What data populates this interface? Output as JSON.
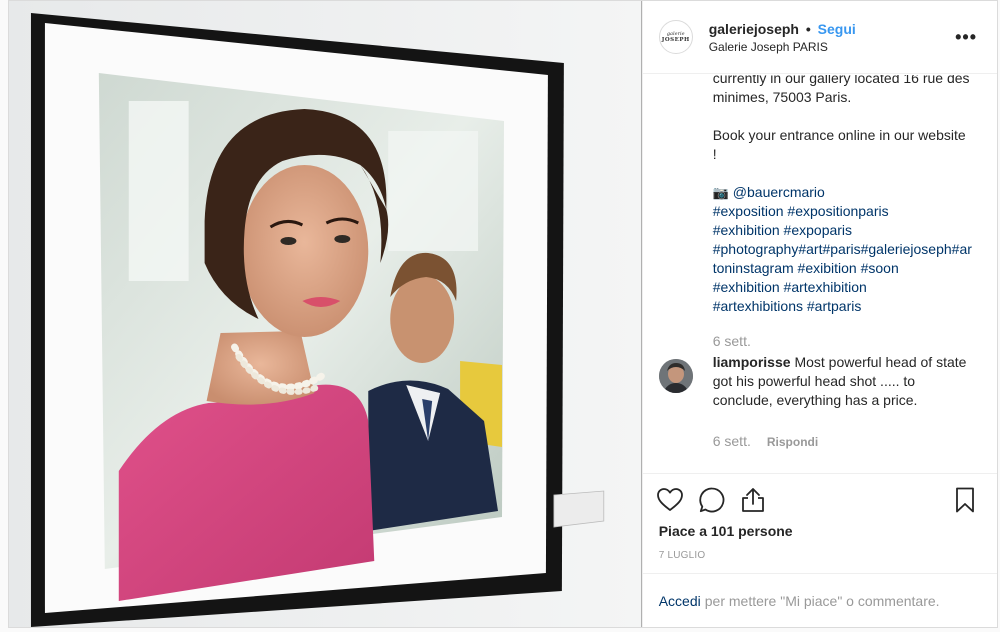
{
  "post": {
    "username": "galeriejoseph",
    "separator": "•",
    "follow_label": "Segui",
    "location": "Galerie Joseph PARIS",
    "more_label": "•••",
    "logo_line1": "galerie",
    "logo_line2": "JOSEPH"
  },
  "caption": {
    "text_line1": "currently in our gallery located 16 rue des minimes, 75003 Paris.",
    "text_line2": "Book your entrance online in our website !",
    "camera_icon": "📷",
    "mention": "@bauercmario",
    "hashtags_line1": "#exposition #expositionparis",
    "hashtags_line2": "#exhibition #expoparis",
    "hashtags_line3": "#photography#art#paris#galeriejoseph#artoninstagram #exibition #soon",
    "hashtags_line4": "#exhibition #artexhibition",
    "hashtags_line5": "#artexhibitions #artparis",
    "time": "6 sett."
  },
  "comment": {
    "username": "liamporisse",
    "text": "Most powerful head of state got his powerful head shot ..... to conclude, everything has a price.",
    "time": "6 sett.",
    "reply_label": "Rispondi"
  },
  "actions": {
    "likes_label": "Piace a 101 persone",
    "date_label": "7 LUGLIO"
  },
  "login": {
    "link_label": "Accedi",
    "rest_label": "per mettere \"Mi piace\" o commentare."
  },
  "colors": {
    "link_blue": "#3897f0",
    "hashtag_blue": "#003569",
    "muted_gray": "#999999"
  }
}
